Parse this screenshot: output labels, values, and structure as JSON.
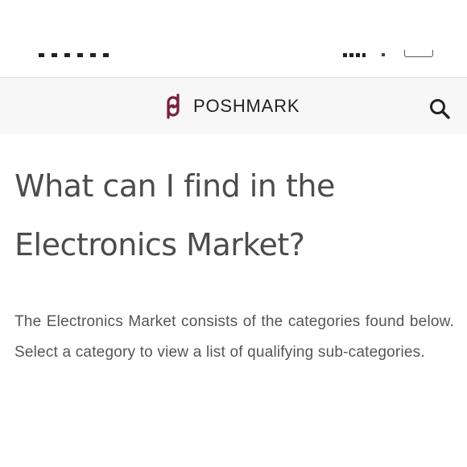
{
  "header": {
    "brand_name": "POSHMARK",
    "icons": {
      "logo": "poshmark-logo-icon",
      "search": "search-icon"
    },
    "colors": {
      "logo": "#7a1f3d",
      "header_bg": "#f7f7f7"
    }
  },
  "main": {
    "headline": "What can I find in the Electronics Market?",
    "body": "The Electronics Market consists of the categories found below. Select a category to view a list of qualifying sub-categories."
  }
}
